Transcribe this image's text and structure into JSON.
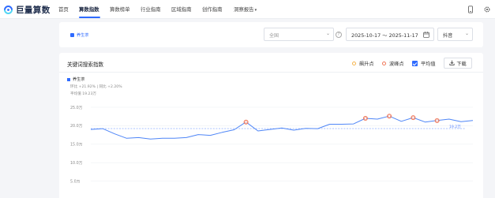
{
  "app": {
    "logo_text": "巨量算数",
    "brand_color": "#2f6bff"
  },
  "nav": {
    "items": [
      {
        "label": "首页"
      },
      {
        "label": "算数指数"
      },
      {
        "label": "算数榜单"
      },
      {
        "label": "行业指南"
      },
      {
        "label": "区域指南"
      },
      {
        "label": "创作指南"
      },
      {
        "label": "洞察报告"
      }
    ],
    "active_index": 1,
    "right_icons": [
      "phone-icon",
      "gear-icon"
    ]
  },
  "filters": {
    "keyword_chip": "养生茶",
    "region_placeholder": "全国",
    "date_range": "2025-10-17 ～ 2025-11-17",
    "platform": "抖音"
  },
  "card": {
    "title": "关键词搜索指数",
    "legend": {
      "rise_label": "飙升点",
      "rise_color": "#f6b54e",
      "peak_label": "波峰点",
      "peak_color": "#f0785a",
      "avg_label": "平均值",
      "avg_checked": true
    },
    "download_label": "下载",
    "series_label": "养生茶",
    "stats": {
      "line1": "环比 +21.92% | 同比 +2.20%",
      "line2": "平均值 19.23万"
    },
    "avg_value_label": "19.2万"
  },
  "chart_data": {
    "type": "line",
    "yticks": [
      "25.0万",
      "20.0万",
      "15.0万",
      "10.0万",
      "5.0万"
    ],
    "ylim": [
      0,
      27
    ],
    "average": 19.23,
    "series": [
      {
        "name": "养生茶",
        "color": "#4f86f7",
        "values": [
          19.0,
          19.2,
          17.8,
          16.6,
          16.8,
          16.4,
          16.6,
          16.6,
          16.8,
          17.6,
          17.4,
          18.2,
          18.9,
          21.0,
          18.6,
          19.0,
          19.4,
          18.8,
          19.3,
          19.2,
          20.4,
          20.4,
          20.5,
          22.0,
          21.8,
          22.6,
          21.2,
          22.2,
          21.0,
          21.4,
          21.8,
          21.1,
          21.4
        ]
      }
    ],
    "peaks": [
      13,
      23,
      25,
      27,
      29
    ]
  }
}
